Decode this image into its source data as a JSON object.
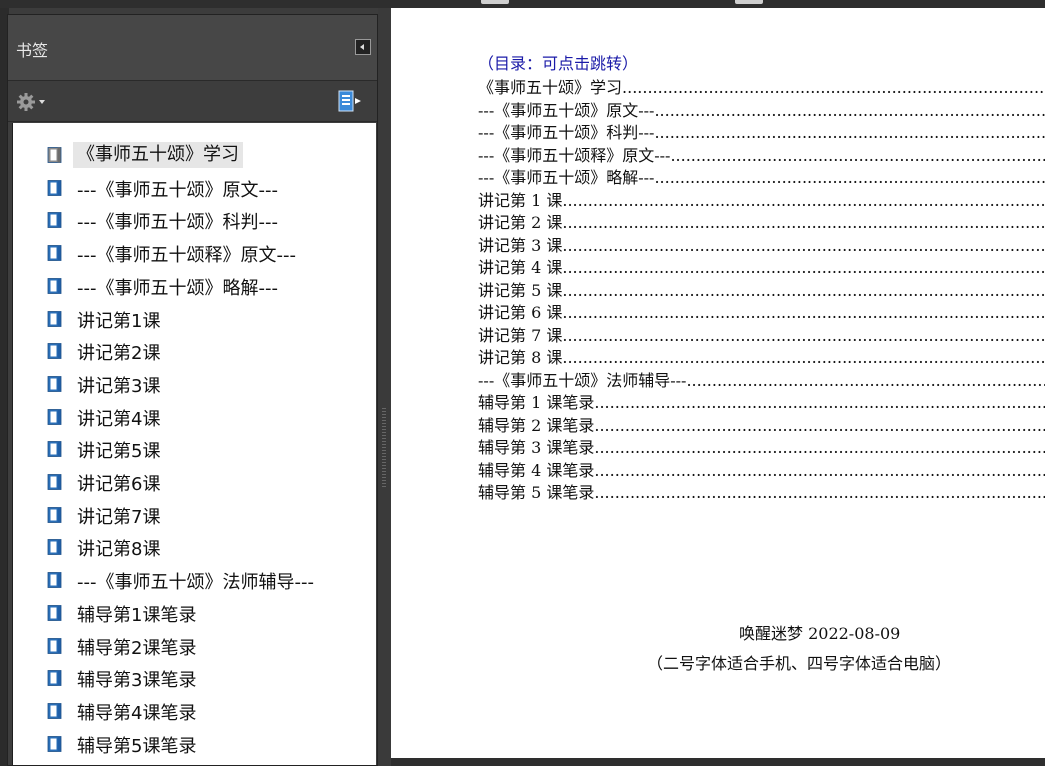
{
  "bookmarks_panel": {
    "title": "书签",
    "items": [
      {
        "label": "《事师五十颂》学习",
        "selected": true
      },
      {
        "label": "---《事师五十颂》原文---"
      },
      {
        "label": "---《事师五十颂》科判---"
      },
      {
        "label": "---《事师五十颂释》原文---"
      },
      {
        "label": "---《事师五十颂》略解---"
      },
      {
        "label": "讲记第1课"
      },
      {
        "label": "讲记第2课"
      },
      {
        "label": "讲记第3课"
      },
      {
        "label": "讲记第4课"
      },
      {
        "label": "讲记第5课"
      },
      {
        "label": "讲记第6课"
      },
      {
        "label": "讲记第7课"
      },
      {
        "label": "讲记第8课"
      },
      {
        "label": "---《事师五十颂》法师辅导---"
      },
      {
        "label": "辅导第1课笔录"
      },
      {
        "label": "辅导第2课笔录"
      },
      {
        "label": "辅导第3课笔录"
      },
      {
        "label": "辅导第4课笔录"
      },
      {
        "label": "辅导第5课笔录"
      }
    ]
  },
  "document": {
    "toc_heading": "（目录：可点击跳转）",
    "toc": [
      "《事师五十颂》学习",
      "---《事师五十颂》原文---",
      "---《事师五十颂》科判---",
      "---《事师五十颂释》原文---",
      "---《事师五十颂》略解---",
      "讲记第 1 课",
      "讲记第 2 课",
      "讲记第 3 课",
      "讲记第 4 课",
      "讲记第 5 课",
      "讲记第 6 课",
      "讲记第 7 课",
      "讲记第 8 课",
      "---《事师五十颂》法师辅导---",
      "辅导第 1 课笔录",
      "辅导第 2 课笔录",
      "辅导第 3 课笔录",
      "辅导第 4 课笔录",
      "辅导第 5 课笔录"
    ],
    "signature": "唤醒迷梦 2022-08-09",
    "note": "（二号字体适合手机、四号字体适合电脑）"
  },
  "colors": {
    "toc_heading": "#1a1aa8",
    "panel_bg": "#3e3e3e",
    "bookmark_icon": "#2a6fb8"
  },
  "icons": {
    "options": "gear-icon",
    "new_bookmark": "new-bookmark-icon",
    "collapse": "collapse-panel-icon",
    "bookmark": "bookmark-icon"
  }
}
